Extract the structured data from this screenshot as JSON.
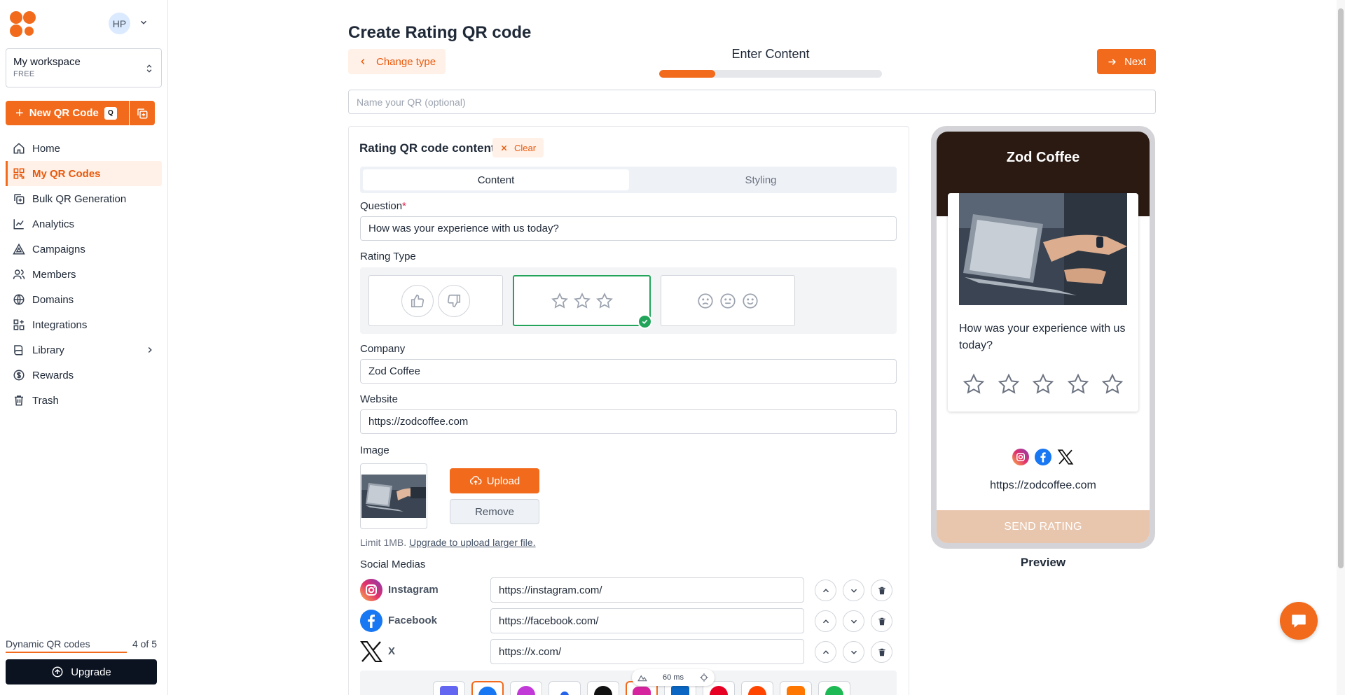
{
  "sidebar": {
    "avatar_initials": "HP",
    "workspace": {
      "name": "My workspace",
      "plan": "FREE"
    },
    "new_qr_label": "New QR Code",
    "new_qr_shortcut": "Q",
    "nav": [
      {
        "label": "Home",
        "icon": "home-icon"
      },
      {
        "label": "My QR Codes",
        "icon": "qr-grid-icon",
        "active": true
      },
      {
        "label": "Bulk QR Generation",
        "icon": "bulk-copy-icon"
      },
      {
        "label": "Analytics",
        "icon": "chart-line-icon"
      },
      {
        "label": "Campaigns",
        "icon": "triangle-icon"
      },
      {
        "label": "Members",
        "icon": "users-icon"
      },
      {
        "label": "Domains",
        "icon": "globe-icon"
      },
      {
        "label": "Integrations",
        "icon": "grid-plus-icon"
      },
      {
        "label": "Library",
        "icon": "book-icon"
      },
      {
        "label": "Rewards",
        "icon": "dollar-circle-icon"
      },
      {
        "label": "Trash",
        "icon": "trash-icon"
      }
    ],
    "dynamic_label": "Dynamic QR codes",
    "dynamic_count": "4 of 5",
    "dynamic_used_fraction": 0.8,
    "upgrade_label": "Upgrade"
  },
  "header": {
    "title": "Create Rating QR code",
    "change_type_label": "Change type",
    "step_label": "Enter Content",
    "step_progress": 0.25,
    "next_label": "Next",
    "name_placeholder": "Name your QR (optional)"
  },
  "content": {
    "title": "Rating QR code content",
    "clear_label": "Clear",
    "tabs": [
      "Content",
      "Styling"
    ],
    "active_tab": "Content",
    "question_label": "Question",
    "question_required_mark": "*",
    "question_value": "How was your experience with us today?",
    "rating_type_label": "Rating Type",
    "rating_types": [
      "thumbs",
      "stars",
      "emoji"
    ],
    "rating_type_selected": "stars",
    "company_label": "Company",
    "company_value": "Zod Coffee",
    "website_label": "Website",
    "website_value": "https://zodcoffee.com",
    "image_label": "Image",
    "upload_label": "Upload",
    "remove_label": "Remove",
    "limit_text": "Limit 1MB.",
    "limit_link": "Upgrade to upload larger file.",
    "social_label": "Social Medias",
    "socials": [
      {
        "name": "Instagram",
        "url": "https://instagram.com/",
        "icon": "instagram-icon"
      },
      {
        "name": "Facebook",
        "url": "https://facebook.com/",
        "icon": "facebook-icon"
      },
      {
        "name": "X",
        "url": "https://x.com/",
        "icon": "x-icon"
      }
    ],
    "fps_readout": "60 ms"
  },
  "preview": {
    "company": "Zod Coffee",
    "question": "How was your experience with us today?",
    "star_count": 5,
    "website": "https://zodcoffee.com",
    "send_label": "SEND RATING",
    "label": "Preview"
  },
  "colors": {
    "accent": "#f26a1b",
    "accent_soft": "#fff1e8",
    "success": "#22a55b",
    "preview_header": "#2a1a12",
    "send_button": "#e8c5ad"
  }
}
